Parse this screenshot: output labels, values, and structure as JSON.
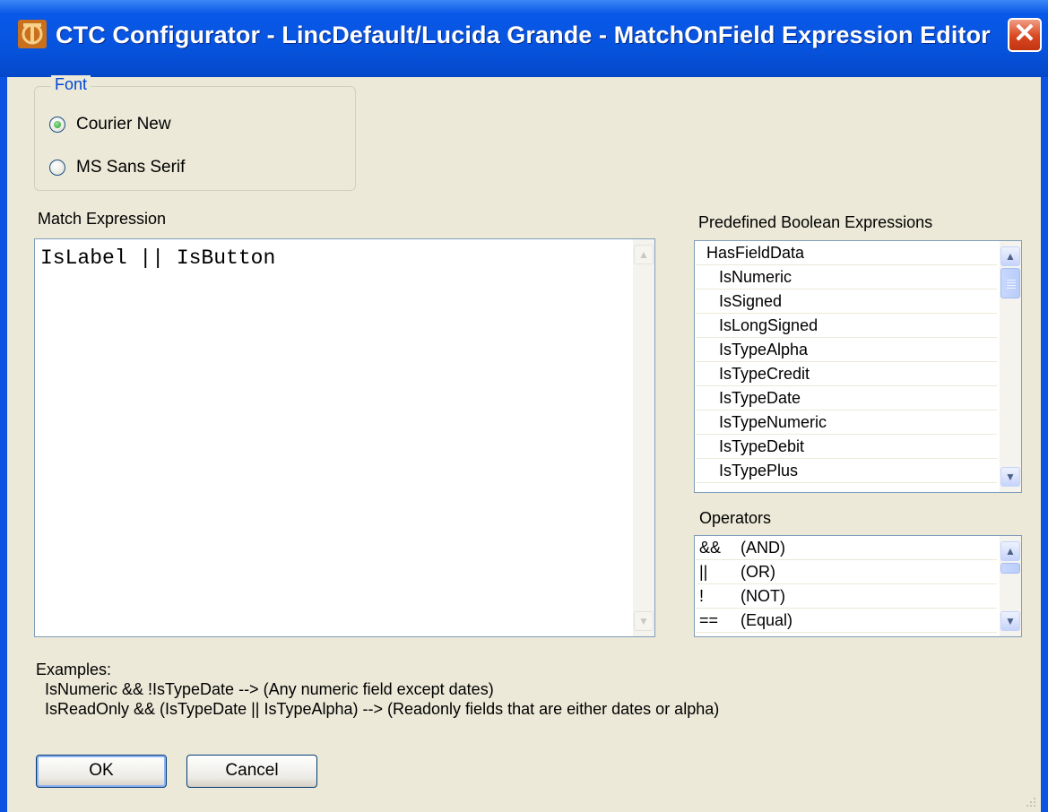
{
  "window": {
    "title": "CTC Configurator - LincDefault/Lucida Grande - MatchOnField Expression Editor",
    "close_glyph": "✕"
  },
  "font_group": {
    "label": "Font",
    "options": [
      {
        "label": "Courier New",
        "selected": true
      },
      {
        "label": "MS Sans Serif",
        "selected": false
      }
    ]
  },
  "match_expression": {
    "label": "Match Expression",
    "value": "IsLabel || IsButton"
  },
  "predefined": {
    "label": "Predefined Boolean Expressions",
    "items": [
      "HasFieldData",
      "IsNumeric",
      "IsSigned",
      "IsLongSigned",
      "IsTypeAlpha",
      "IsTypeCredit",
      "IsTypeDate",
      "IsTypeNumeric",
      "IsTypeDebit",
      "IsTypePlus"
    ]
  },
  "operators": {
    "label": "Operators",
    "items": [
      {
        "symbol": "&&",
        "name": "(AND)"
      },
      {
        "symbol": "||",
        "name": "(OR)"
      },
      {
        "symbol": "!",
        "name": "(NOT)"
      },
      {
        "symbol": "==",
        "name": "(Equal)"
      }
    ]
  },
  "examples": {
    "heading": "Examples:",
    "lines": [
      "IsNumeric && !IsTypeDate --> (Any numeric field except dates)",
      "IsReadOnly && (IsTypeDate || IsTypeAlpha) --> (Readonly fields that are either dates or alpha)"
    ]
  },
  "buttons": {
    "ok": "OK",
    "cancel": "Cancel"
  },
  "icons": {
    "app": "ctc-logo-icon",
    "close": "close-icon",
    "scroll_up": "chevron-up-icon",
    "scroll_down": "chevron-down-icon",
    "resize": "resize-grip-icon"
  },
  "colors": {
    "titlebar": "#0654de",
    "client_bg": "#ece9d8",
    "group_label": "#0046d5",
    "close_button": "#d9471f"
  }
}
